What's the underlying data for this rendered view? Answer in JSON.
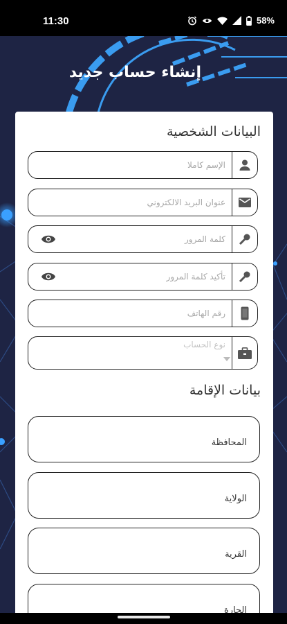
{
  "status": {
    "time": "11:30",
    "battery": "58%",
    "icons": [
      "alarm-icon",
      "eye-icon",
      "wifi-icon",
      "signal-icon",
      "battery-icon"
    ]
  },
  "page": {
    "title": "إنشاء حساب جديد"
  },
  "personal": {
    "title": "البيانات الشخصية",
    "fields": {
      "full_name": {
        "placeholder": "الإسم كاملا",
        "icon": "person-icon"
      },
      "email": {
        "placeholder": "عنوان البريد الالكتروني",
        "icon": "mail-icon"
      },
      "password": {
        "placeholder": "كلمة المرور",
        "icon": "key-icon"
      },
      "confirm_password": {
        "placeholder": "تأكيد كلمة المرور",
        "icon": "key-icon"
      },
      "phone": {
        "placeholder": "رقم الهاتف",
        "icon": "phone-icon"
      },
      "account_type": {
        "placeholder": "نوع الحساب",
        "icon": "briefcase-icon"
      }
    }
  },
  "residence": {
    "title": "بيانات الإقامة",
    "governorate": "المحافظة",
    "state": "الولاية",
    "village": "القرية",
    "neighborhood": "الحارة"
  },
  "colors": {
    "background": "#1e2444",
    "accent": "#3aa0ff",
    "card": "#ffffff",
    "border": "#222222"
  }
}
